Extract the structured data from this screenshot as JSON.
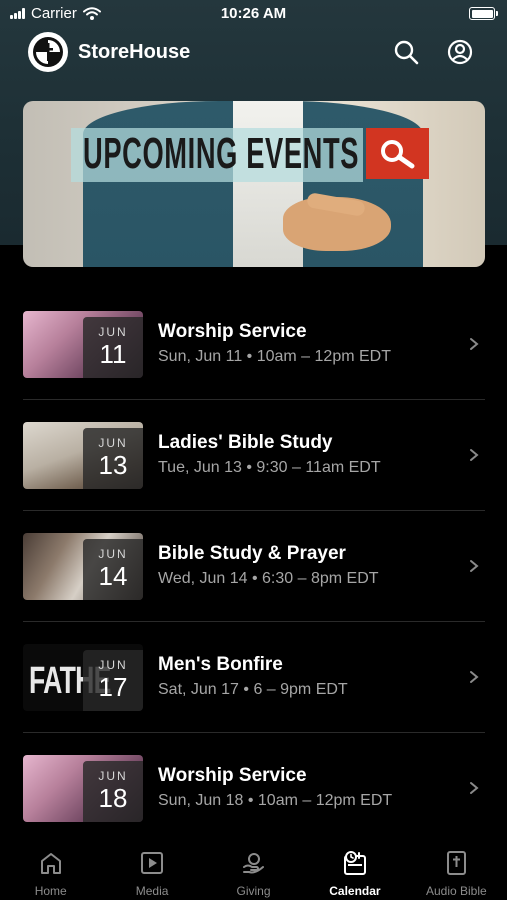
{
  "status_bar": {
    "carrier": "Carrier",
    "time": "10:26 AM"
  },
  "header": {
    "app_name": "StoreHouse"
  },
  "banner": {
    "title": "UPCOMING EVENTS"
  },
  "events": [
    {
      "month": "JUN",
      "day": "11",
      "title": "Worship Service",
      "subtitle": "Sun, Jun 11 • 10am – 12pm EDT",
      "thumbnail_label": ""
    },
    {
      "month": "JUN",
      "day": "13",
      "title": "Ladies' Bible Study",
      "subtitle": "Tue, Jun 13 • 9:30 – 11am EDT",
      "thumbnail_label": ""
    },
    {
      "month": "JUN",
      "day": "14",
      "title": "Bible Study & Prayer",
      "subtitle": "Wed, Jun 14 • 6:30 – 8pm EDT",
      "thumbnail_label": ""
    },
    {
      "month": "JUN",
      "day": "17",
      "title": "Men's Bonfire",
      "subtitle": "Sat, Jun 17 • 6 – 9pm EDT",
      "thumbnail_label": "FATHE"
    },
    {
      "month": "JUN",
      "day": "18",
      "title": "Worship Service",
      "subtitle": "Sun, Jun 18 • 10am – 12pm EDT",
      "thumbnail_label": ""
    }
  ],
  "tabs": [
    {
      "label": "Home",
      "icon": "home-icon",
      "active": false
    },
    {
      "label": "Media",
      "icon": "play-icon",
      "active": false
    },
    {
      "label": "Giving",
      "icon": "giving-icon",
      "active": false
    },
    {
      "label": "Calendar",
      "icon": "calendar-icon",
      "active": true
    },
    {
      "label": "Audio Bible",
      "icon": "bible-icon",
      "active": false
    }
  ],
  "colors": {
    "background": "#000000",
    "header_bg": "#1f3339",
    "muted_text": "#a6a6a6",
    "banner_accent": "#d23521"
  }
}
